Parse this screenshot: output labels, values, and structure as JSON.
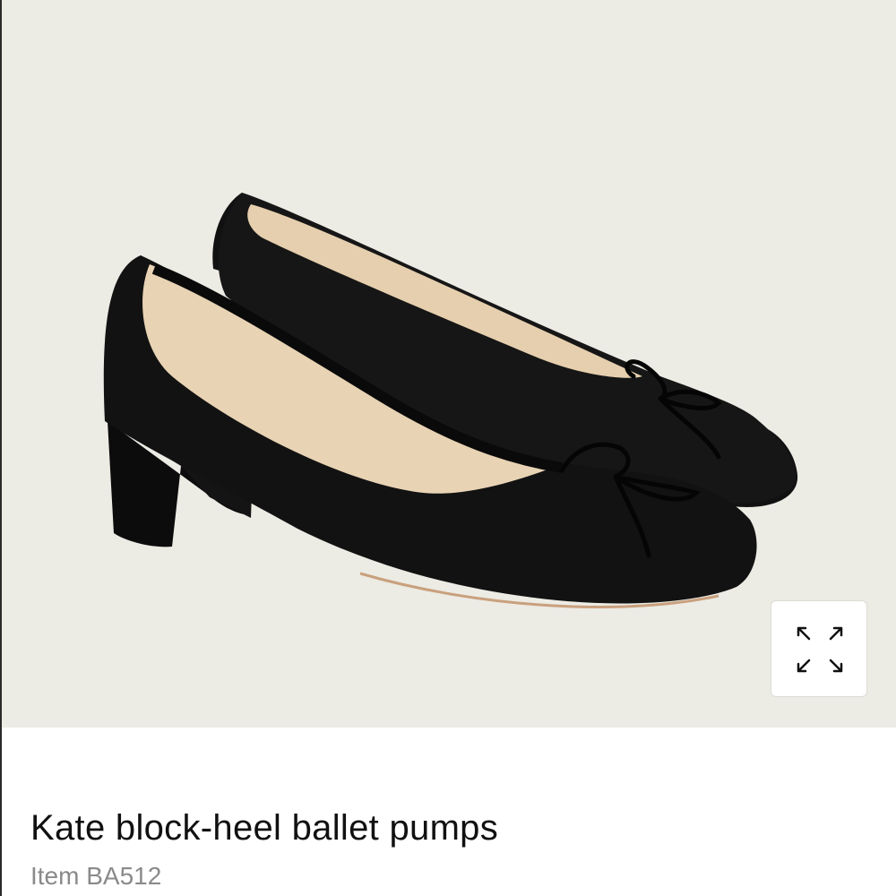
{
  "product": {
    "name": "Kate block-heel ballet pumps",
    "item_label": "Item BA512"
  },
  "image": {
    "subject": "black leather block-heel ballet pumps with bow",
    "background_color": "#ecebe4"
  },
  "controls": {
    "expand_icon": "expand-arrows-icon"
  }
}
